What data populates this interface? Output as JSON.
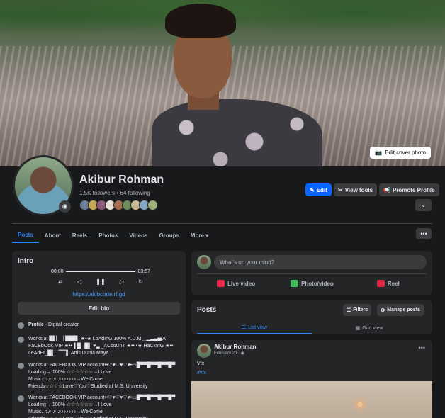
{
  "cover": {
    "edit_label": "Edit cover photo"
  },
  "profile": {
    "name": "Akibur Rohman",
    "followers": "1.5K followers • 64 following"
  },
  "header_buttons": {
    "edit": "Edit",
    "view_tools": "View tools",
    "promote": "Promote Profile"
  },
  "tabs": [
    "Posts",
    "About",
    "Reels",
    "Photos",
    "Videos",
    "Groups",
    "More ▾"
  ],
  "intro": {
    "title": "Intro",
    "time_start": "00:00",
    "time_end": "03:57",
    "link": "https://akibcode.rf.gd",
    "edit_bio": "Edit bio",
    "rows": [
      {
        "bold": "Profile",
        "text": " · Digital creator"
      },
      {
        "text": "Works at █▌▏▕ ███▌ ★•★ LoAdInG 100% A.D.M ▁▂▃▄▅ AT FaCEbOoK VIP ★•• ▌█▏█▌ ♥▂ _ACcoUnT ★•• •★ HaCkInG ★•• LeAdEr_█▌▏▔▔▌ Artis Dunia Maya"
      },
      {
        "text": "Works at FACEBOOK VIP account••♡♥♡♥♡♥•▭█▀▀█▀▀█▀▀█▀ Loading→ 100% ☆☆☆☆☆☆→I Love Music♪♫♬♬♫♪♪♪♪♪♪→WelCome Friends☆☆☆☆Love♡You♡Studied at M.S. University"
      },
      {
        "text": "Works at FACEBOOK VIP account••♡♥♡♥♡♥•▭█▀▀█▀▀█▀▀█▀ Loading→ 100% ☆☆☆☆☆☆→I Love Music♪♫♬♬♫♪♪♪♪♪♪→WelCome Friends☆☆☆☆Love♡You♡Studied at M.S. University"
      }
    ]
  },
  "composer": {
    "placeholder": "What's on your mind?",
    "live": "Live video",
    "photo": "Photo/video",
    "reel": "Reel"
  },
  "posts": {
    "title": "Posts",
    "filters": "Filters",
    "manage": "Manage posts",
    "list_view": "List view",
    "grid_view": "Grid view"
  },
  "post": {
    "author": "Akibur Rohman",
    "date": "February 20 · ◉",
    "text": "Vfx",
    "tag": "#vfx"
  },
  "colors": {
    "accent": "#0866ff",
    "link": "#4599ff",
    "bg": "#18191a",
    "card": "#242526"
  }
}
